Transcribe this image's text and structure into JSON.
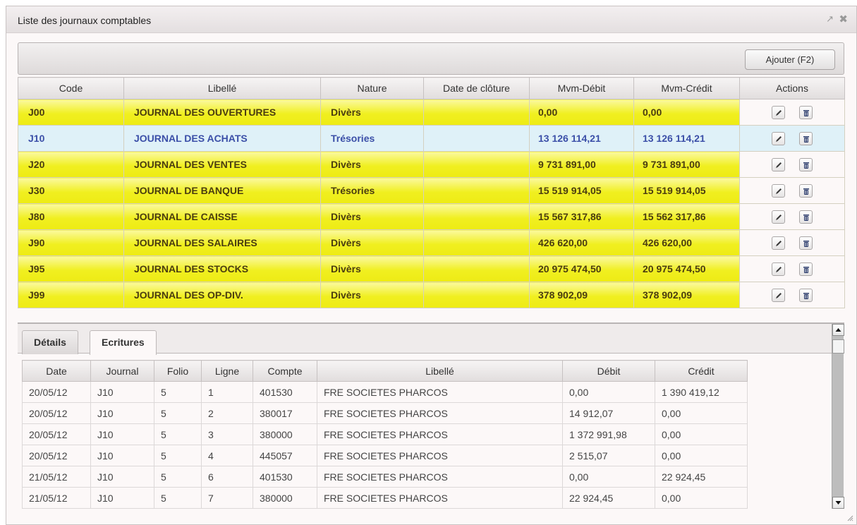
{
  "window": {
    "title": "Liste des journaux comptables"
  },
  "toolbar": {
    "add_label": "Ajouter (F2)"
  },
  "journals": {
    "headers": {
      "code": "Code",
      "libelle": "Libellé",
      "nature": "Nature",
      "date_cloture": "Date de clôture",
      "mvm_debit": "Mvm-Débit",
      "mvm_credit": "Mvm-Crédit",
      "actions": "Actions"
    },
    "rows": [
      {
        "code": "J00",
        "libelle": "JOURNAL DES OUVERTURES",
        "nature": "Divèrs",
        "date": "",
        "debit": "0,00",
        "credit": "0,00"
      },
      {
        "code": "J10",
        "libelle": "JOURNAL DES ACHATS",
        "nature": "Trésories",
        "date": "",
        "debit": "13 126 114,21",
        "credit": "13 126 114,21"
      },
      {
        "code": "J20",
        "libelle": "JOURNAL DES VENTES",
        "nature": "Divèrs",
        "date": "",
        "debit": "9 731 891,00",
        "credit": "9 731 891,00"
      },
      {
        "code": "J30",
        "libelle": "JOURNAL DE BANQUE",
        "nature": "Trésories",
        "date": "",
        "debit": "15 519 914,05",
        "credit": "15 519 914,05"
      },
      {
        "code": "J80",
        "libelle": "JOURNAL DE CAISSE",
        "nature": "Divèrs",
        "date": "",
        "debit": "15 567 317,86",
        "credit": "15 562 317,86"
      },
      {
        "code": "J90",
        "libelle": "JOURNAL DES SALAIRES",
        "nature": "Divèrs",
        "date": "",
        "debit": "426 620,00",
        "credit": "426 620,00"
      },
      {
        "code": "J95",
        "libelle": "JOURNAL DES STOCKS",
        "nature": "Divèrs",
        "date": "",
        "debit": "20 975 474,50",
        "credit": "20 975 474,50"
      },
      {
        "code": "J99",
        "libelle": "JOURNAL DES OP-DIV.",
        "nature": "Divèrs",
        "date": "",
        "debit": "378 902,09",
        "credit": "378 902,09"
      }
    ],
    "selected_code": "J10"
  },
  "tabs": {
    "details": "Détails",
    "ecritures": "Ecritures",
    "active": "ecritures"
  },
  "ecritures": {
    "headers": {
      "date": "Date",
      "journal": "Journal",
      "folio": "Folio",
      "ligne": "Ligne",
      "compte": "Compte",
      "libelle": "Libellé",
      "debit": "Débit",
      "credit": "Crédit"
    },
    "rows": [
      {
        "date": "20/05/12",
        "journal": "J10",
        "folio": "5",
        "ligne": "1",
        "compte": "401530",
        "libelle": "FRE SOCIETES PHARCOS",
        "debit": "0,00",
        "credit": "1 390 419,12"
      },
      {
        "date": "20/05/12",
        "journal": "J10",
        "folio": "5",
        "ligne": "2",
        "compte": "380017",
        "libelle": "FRE SOCIETES PHARCOS",
        "debit": "14 912,07",
        "credit": "0,00"
      },
      {
        "date": "20/05/12",
        "journal": "J10",
        "folio": "5",
        "ligne": "3",
        "compte": "380000",
        "libelle": "FRE SOCIETES PHARCOS",
        "debit": "1 372 991,98",
        "credit": "0,00"
      },
      {
        "date": "20/05/12",
        "journal": "J10",
        "folio": "5",
        "ligne": "4",
        "compte": "445057",
        "libelle": "FRE SOCIETES PHARCOS",
        "debit": "2 515,07",
        "credit": "0,00"
      },
      {
        "date": "21/05/12",
        "journal": "J10",
        "folio": "5",
        "ligne": "6",
        "compte": "401530",
        "libelle": "FRE SOCIETES PHARCOS",
        "debit": "0,00",
        "credit": "22 924,45"
      },
      {
        "date": "21/05/12",
        "journal": "J10",
        "folio": "5",
        "ligne": "7",
        "compte": "380000",
        "libelle": "FRE SOCIETES PHARCOS",
        "debit": "22 924,45",
        "credit": "0,00"
      }
    ]
  },
  "icons": {
    "restore": "popout-icon",
    "close": "close-icon",
    "edit": "pencil-icon",
    "delete": "trash-icon"
  },
  "colors": {
    "row_yellow": "#f0ef20",
    "row_selected": "#dff1f8",
    "row_text": "#4a3c10",
    "selected_text": "#3b4fa8"
  }
}
